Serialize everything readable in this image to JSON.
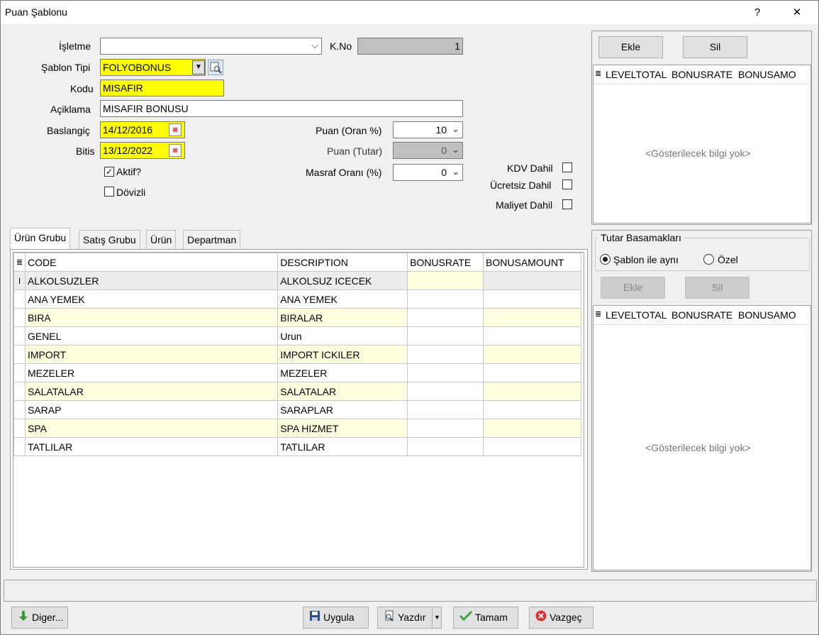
{
  "window": {
    "title": "Puan Şablonu",
    "help": "?",
    "close": "✕"
  },
  "form": {
    "isletme_label": "İşletme",
    "isletme_value": "",
    "kno_label": "K.No",
    "kno_value": "1",
    "sablon_tipi_label": "Şablon Tipi",
    "sablon_tipi_value": "FOLYOBONUS",
    "kodu_label": "Kodu",
    "kodu_value": "MISAFIR",
    "aciklama_label": "Açiklama",
    "aciklama_value": "MISAFIR BONUSU",
    "baslangic_label": "Baslangiç",
    "baslangic_value": "14/12/2016",
    "bitis_label": "Bitis",
    "bitis_value": "13/12/2022",
    "aktif_label": "Aktif?",
    "aktif_checked": "✓",
    "dovizli_label": "Dövizli",
    "puan_oran_label": "Puan (Oran %)",
    "puan_oran_value": "10",
    "puan_tutar_label": "Puan (Tutar)",
    "puan_tutar_value": "0",
    "masraf_label": "Masraf Oranı (%)",
    "masraf_value": "0",
    "kdv_label": "KDV Dahil",
    "ucretsiz_label": "Ücretsiz Dahil",
    "maliyet_label": "Maliyet Dahil"
  },
  "top_right": {
    "ekle": "Ekle",
    "sil": "Sil",
    "columns": [
      "LEVELTOTAL",
      "BONUSRATE",
      "BONUSAMO"
    ],
    "empty": "<Gösterilecek bilgi yok>"
  },
  "tutar": {
    "group_label": "Tutar Basamakları",
    "radio1": "Şablon ile aynı",
    "radio2": "Özel",
    "ekle": "Ekle",
    "sil": "Sil",
    "columns": [
      "LEVELTOTAL",
      "BONUSRATE",
      "BONUSAMO"
    ],
    "empty": "<Gösterilecek bilgi yok>"
  },
  "tabs": [
    "Ürün Grubu",
    "Satış Grubu",
    "Ürün",
    "Departman"
  ],
  "grid": {
    "columns": [
      "CODE",
      "DESCRIPTION",
      "BONUSRATE",
      "BONUSAMOUNT"
    ],
    "rows": [
      {
        "code": "ALKOLSUZLER",
        "desc": "ALKOLSUZ ICECEK",
        "rate": "",
        "amount": ""
      },
      {
        "code": "ANA YEMEK",
        "desc": "ANA YEMEK",
        "rate": "",
        "amount": ""
      },
      {
        "code": "BIRA",
        "desc": "BIRALAR",
        "rate": "",
        "amount": ""
      },
      {
        "code": "GENEL",
        "desc": "Urun",
        "rate": "",
        "amount": ""
      },
      {
        "code": "IMPORT",
        "desc": "IMPORT ICKILER",
        "rate": "",
        "amount": ""
      },
      {
        "code": "MEZELER",
        "desc": "MEZELER",
        "rate": "",
        "amount": ""
      },
      {
        "code": "SALATALAR",
        "desc": "SALATALAR",
        "rate": "",
        "amount": ""
      },
      {
        "code": "SARAP",
        "desc": "SARAPLAR",
        "rate": "",
        "amount": ""
      },
      {
        "code": "SPA",
        "desc": "SPA HIZMET",
        "rate": "",
        "amount": ""
      },
      {
        "code": "TATLILAR",
        "desc": "TATLILAR",
        "rate": "",
        "amount": ""
      }
    ]
  },
  "buttons": {
    "diger": "Diger...",
    "uygula": "Uygula",
    "yazdir": "Yazdır",
    "tamam": "Tamam",
    "vazgec": "Vazgeç"
  },
  "colors": {
    "required_field": "#ffff00",
    "alt_row": "#ffffe0"
  }
}
